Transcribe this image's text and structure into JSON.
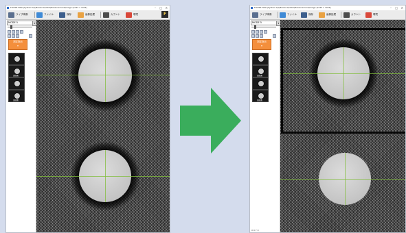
{
  "windows": {
    "left": {
      "title": "FOOSE-Filter(System D)\\Measure\\Data\\Measurement\\Image (1024 x 1024)",
      "toolbar": {
        "live_label": "ライブ映像",
        "file_label": "ファイル",
        "save_label": "保存",
        "measure_label": "画像処理",
        "count_label": "カウント",
        "settings_label": "環境"
      },
      "sidebar": {
        "mode_label": "MODE 5",
        "tool_label": "測定指示",
        "thumb_tag_1": "1 2 3",
        "thumb_tag_2": "1 2 3"
      }
    },
    "right": {
      "title": "FOOSE-Filter(System D)\\Measure\\Data\\Measurement\\Image (1024 x 1024)",
      "toolbar": {
        "live_label": "ライブ映像",
        "file_label": "ファイル",
        "save_label": "保存",
        "measure_label": "画像処理",
        "count_label": "カウント",
        "settings_label": "環境"
      },
      "sidebar": {
        "mode_label": "MODE 5",
        "tool_label": "測定指示",
        "thumb_tag_1": "1 2 3",
        "thumb_tag_2": "1 2 3",
        "status": "X 0  Y 0"
      }
    }
  },
  "colors": {
    "background": "#d4dced",
    "arrow": "#3aad5c",
    "tool_button": "#f48f3c",
    "crosshair": "#82be3c"
  },
  "icons": {
    "transition": "right-arrow-icon",
    "live": "camera-icon",
    "file": "folder-icon",
    "save": "disk-icon",
    "measure": "image-process-icon",
    "count": "counter-icon",
    "settings": "settings-icon"
  }
}
